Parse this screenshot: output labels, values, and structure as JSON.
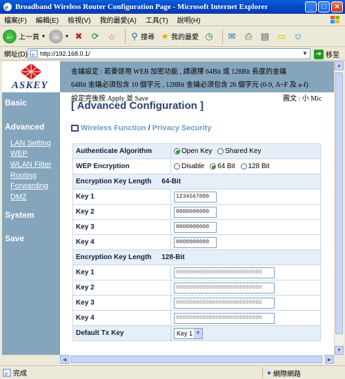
{
  "window": {
    "title": "Broadband Wireless Router Configuration Page - Microsoft Internet Explorer"
  },
  "menu": [
    "檔案(F)",
    "編輯(E)",
    "檢視(V)",
    "我的最愛(A)",
    "工具(T)",
    "說明(H)"
  ],
  "toolbar": {
    "back": "上一頁",
    "search": "搜尋",
    "favorites": "我的最愛"
  },
  "address": {
    "label": "網址(D)",
    "url": "http://192.168.0.1/",
    "go": "移至"
  },
  "status": {
    "left": "完成",
    "zone": "網際網路"
  },
  "logo": {
    "text": "ASKEY"
  },
  "banner": {
    "line1": "金鑰設定 : 若要啓用 WEB 加密功能 , 請選擇 64Bit 或 128Bit 長度的金鑰",
    "line2": "64Bit 金鑰必須包含 10 個字元 , 128Bit 金鑰必須包含 26 個字元 (0-9, A~F 及 a-f)"
  },
  "hint": "設定完後按 Apply 並 Save",
  "lang": "圖文 : 小 Mic",
  "nav": {
    "basic": "Basic",
    "advanced": "Advanced",
    "items": [
      "LAN Setting",
      "WEP",
      "WLAN Filter",
      "Routing",
      "Forwarding",
      "DMZ"
    ],
    "system": "System",
    "save": "Save"
  },
  "page": {
    "heading": "[ Advanced Configuration ]",
    "section": "Wireless Function",
    "section_sep": "/",
    "subsection": "Privacy Security"
  },
  "form": {
    "auth_label": "Authenticate Algorithm",
    "auth_opts": [
      "Open Key",
      "Shared Key"
    ],
    "auth_selected": "Open Key",
    "wep_label": "WEP Encryption",
    "wep_opts": [
      "Disable",
      "64 Bit",
      "128 Bit"
    ],
    "wep_selected": "64 Bit",
    "len_label": "Encryption Key Length",
    "len64": "64-Bit",
    "len128": "128-Bit",
    "key_labels": [
      "Key 1",
      "Key 2",
      "Key 3",
      "Key 4"
    ],
    "keys64": [
      "1234567890",
      "0000000000",
      "0000000000",
      "0000000000"
    ],
    "keys128": [
      "00000000000000000000000000",
      "00000000000000000000000000",
      "00000000000000000000000000",
      "00000000000000000000000000"
    ],
    "default_label": "Default Tx Key",
    "default_value": "Key 1"
  },
  "colors": {
    "nav_bg": "#85a5bd",
    "heading": "#2a3e73",
    "row_shade": "#e6eef7"
  }
}
